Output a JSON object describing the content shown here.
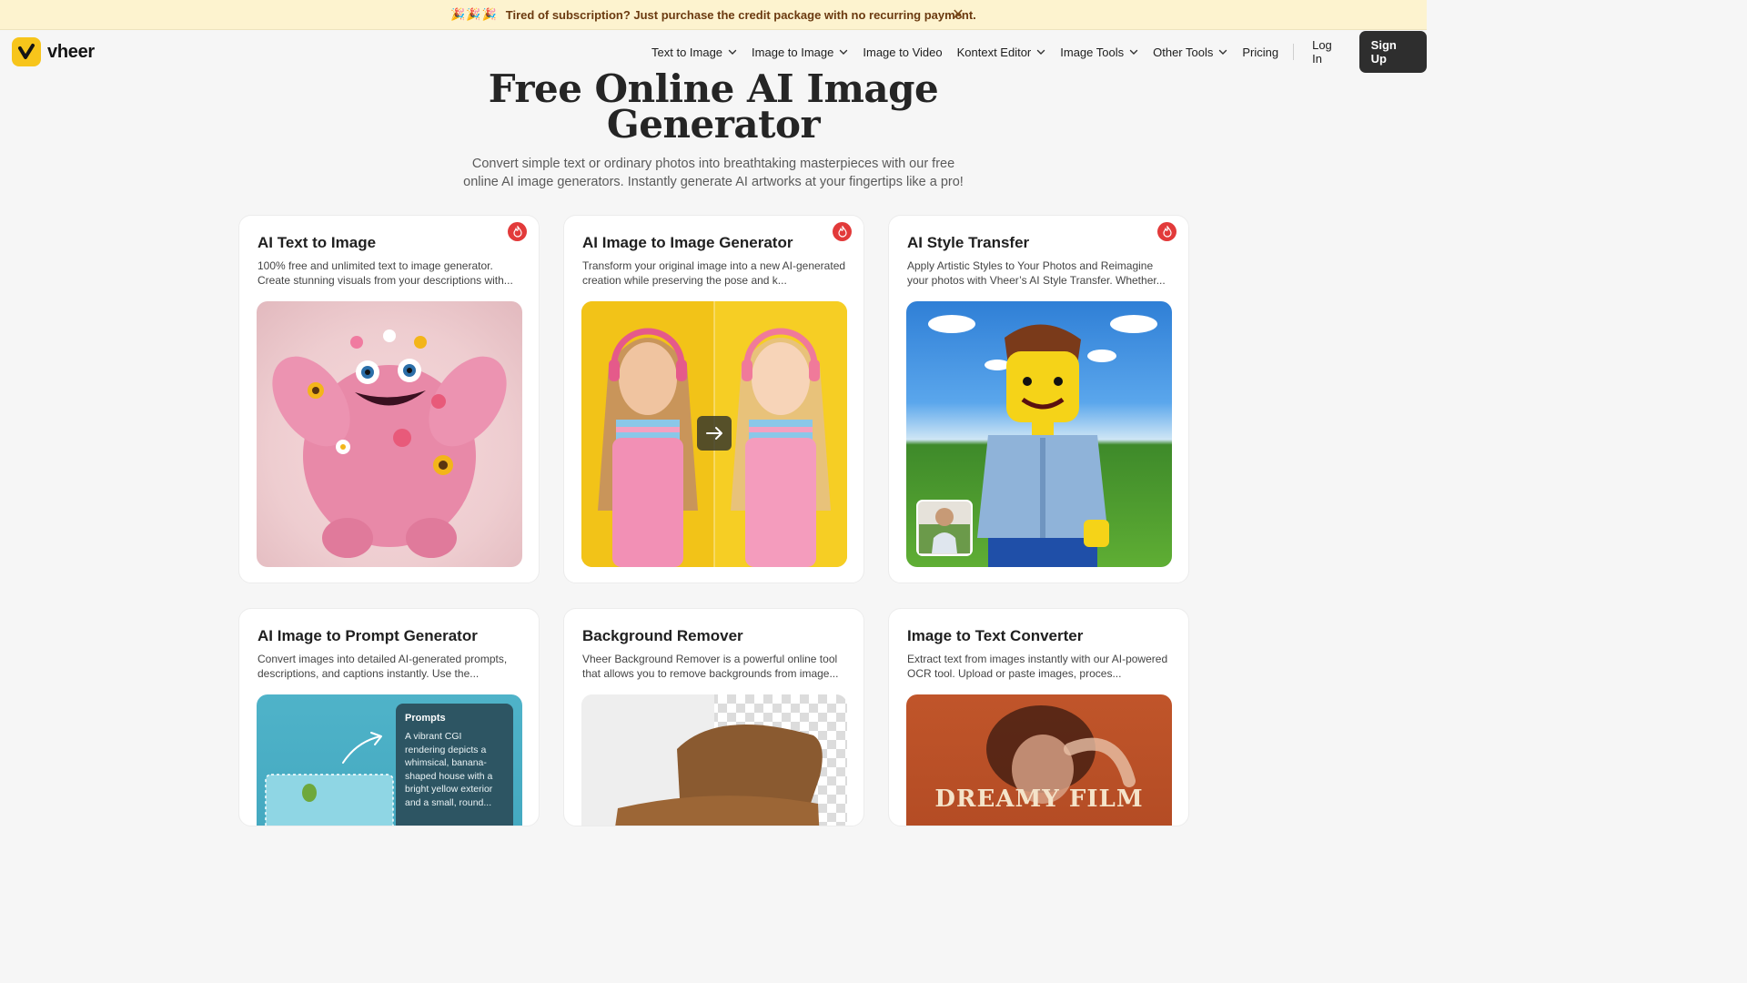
{
  "promo": {
    "emoji": "🎉🎉🎉",
    "message": "Tired of subscription? Just purchase the credit package with no recurring payment.",
    "close": "✕"
  },
  "brand": {
    "name": "vheer",
    "color": "#f7c51b"
  },
  "nav": {
    "items": [
      {
        "label": "Text to Image",
        "dropdown": true
      },
      {
        "label": "Image to Image",
        "dropdown": true
      },
      {
        "label": "Image to Video",
        "dropdown": false
      },
      {
        "label": "Kontext Editor",
        "dropdown": true
      },
      {
        "label": "Image Tools",
        "dropdown": true
      },
      {
        "label": "Other Tools",
        "dropdown": true
      },
      {
        "label": "Pricing",
        "dropdown": false
      }
    ],
    "login": "Log In",
    "signup": "Sign Up"
  },
  "hero": {
    "title_line1": "Free Online AI Image",
    "title_line2": "Generator",
    "subtitle": "Convert simple text or ordinary photos into breathtaking masterpieces with our free online AI image generators. Instantly generate AI artworks at your fingertips like a pro!"
  },
  "cards": [
    {
      "title": "AI Text to Image",
      "desc": "100% free and unlimited text to image generator. Create stunning visuals from your descriptions with...",
      "hot": true,
      "icon": "fire-icon"
    },
    {
      "title": "AI Image to Image Generator",
      "desc": "Transform your original image into a new AI-generated creation while preserving the pose and k...",
      "hot": true,
      "icon": "fire-icon"
    },
    {
      "title": "AI Style Transfer",
      "desc": "Apply Artistic Styles to Your Photos and Reimagine your photos with Vheer’s AI Style Transfer. Whether...",
      "hot": true,
      "icon": "fire-icon"
    },
    {
      "title": "AI Image to Prompt Generator",
      "desc": "Convert images into detailed AI-generated prompts, descriptions, and captions instantly. Use the...",
      "hot": false
    },
    {
      "title": "Background Remover",
      "desc": "Vheer Background Remover is a powerful online tool that allows you to remove backgrounds from image...",
      "hot": false
    },
    {
      "title": "Image to Text Converter",
      "desc": "Extract text from images instantly with our AI-powered OCR tool. Upload or paste images, proces...",
      "hot": false
    }
  ],
  "prompt_preview": {
    "title": "Prompts",
    "body": "A vibrant CGI rendering depicts a whimsical, banana-shaped house with a bright yellow exterior and a small, round..."
  },
  "ocr_preview": {
    "text": "DREAMY FILM"
  }
}
